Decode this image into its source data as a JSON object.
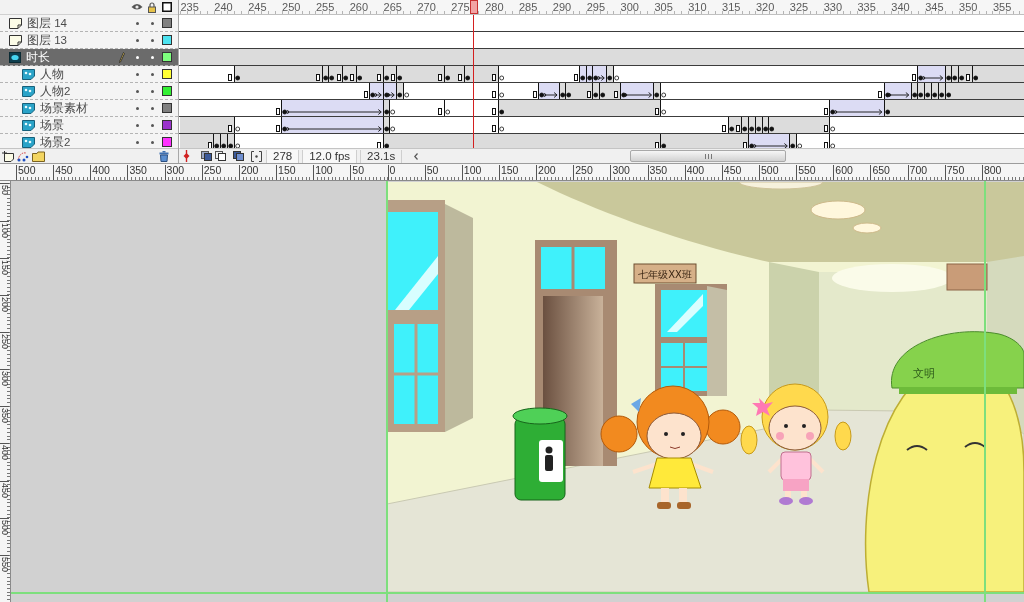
{
  "timeline": {
    "frame_numbers": [
      "235",
      "240",
      "245",
      "250",
      "255",
      "260",
      "265",
      "270",
      "275",
      "280",
      "285",
      "290",
      "295",
      "300",
      "305",
      "310",
      "315",
      "320",
      "325",
      "330",
      "335",
      "340",
      "345",
      "350",
      "355"
    ],
    "layers": [
      {
        "name": "图层 14",
        "kind": "normal",
        "selected": false,
        "visible": true,
        "locked": false,
        "color": "#808080"
      },
      {
        "name": "图层 13",
        "kind": "normal",
        "selected": false,
        "visible": true,
        "locked": false,
        "color": "#4de3f0"
      },
      {
        "name": "时长",
        "kind": "mask",
        "selected": true,
        "visible": true,
        "locked": false,
        "color": "#7dff7d",
        "children": [
          {
            "name": "人物",
            "kind": "masked",
            "selected": false,
            "visible": true,
            "locked": false,
            "color": "#ffff33"
          },
          {
            "name": "人物2",
            "kind": "masked",
            "selected": false,
            "visible": true,
            "locked": false,
            "color": "#33f033"
          },
          {
            "name": "场景素材",
            "kind": "masked",
            "selected": false,
            "visible": true,
            "locked": false,
            "color": "#808080"
          },
          {
            "name": "场景",
            "kind": "masked",
            "selected": false,
            "visible": true,
            "locked": false,
            "color": "#9a33cc"
          },
          {
            "name": "场景2",
            "kind": "masked",
            "selected": false,
            "visible": true,
            "locked": false,
            "color": "#ff33ff"
          }
        ]
      }
    ],
    "toolbar": {
      "current_frame": "278",
      "frame_rate": "12.0 fps",
      "elapsed_time": "23.1s"
    }
  },
  "stage": {
    "horizontal_ruler": [
      "500",
      "450",
      "400",
      "350",
      "300",
      "250",
      "200",
      "150",
      "100",
      "50",
      "0",
      "50",
      "100",
      "150",
      "200",
      "250",
      "300",
      "350",
      "400",
      "450",
      "500",
      "550",
      "600",
      "650",
      "700",
      "750",
      "800"
    ],
    "vertical_ruler": [
      "50",
      "100",
      "150",
      "200",
      "250",
      "300",
      "350",
      "400",
      "450",
      "500",
      "550"
    ],
    "sign": "七年级XX班",
    "cap_text": "文明"
  }
}
